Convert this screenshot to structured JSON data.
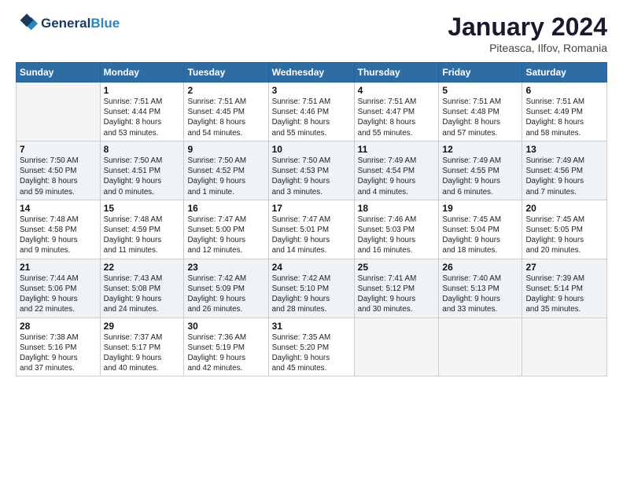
{
  "header": {
    "logo_line1": "General",
    "logo_line2": "Blue",
    "month_title": "January 2024",
    "location": "Piteasca, Ilfov, Romania"
  },
  "days_of_week": [
    "Sunday",
    "Monday",
    "Tuesday",
    "Wednesday",
    "Thursday",
    "Friday",
    "Saturday"
  ],
  "weeks": [
    [
      {
        "num": "",
        "text": ""
      },
      {
        "num": "1",
        "text": "Sunrise: 7:51 AM\nSunset: 4:44 PM\nDaylight: 8 hours\nand 53 minutes."
      },
      {
        "num": "2",
        "text": "Sunrise: 7:51 AM\nSunset: 4:45 PM\nDaylight: 8 hours\nand 54 minutes."
      },
      {
        "num": "3",
        "text": "Sunrise: 7:51 AM\nSunset: 4:46 PM\nDaylight: 8 hours\nand 55 minutes."
      },
      {
        "num": "4",
        "text": "Sunrise: 7:51 AM\nSunset: 4:47 PM\nDaylight: 8 hours\nand 55 minutes."
      },
      {
        "num": "5",
        "text": "Sunrise: 7:51 AM\nSunset: 4:48 PM\nDaylight: 8 hours\nand 57 minutes."
      },
      {
        "num": "6",
        "text": "Sunrise: 7:51 AM\nSunset: 4:49 PM\nDaylight: 8 hours\nand 58 minutes."
      }
    ],
    [
      {
        "num": "7",
        "text": "Sunrise: 7:50 AM\nSunset: 4:50 PM\nDaylight: 8 hours\nand 59 minutes."
      },
      {
        "num": "8",
        "text": "Sunrise: 7:50 AM\nSunset: 4:51 PM\nDaylight: 9 hours\nand 0 minutes."
      },
      {
        "num": "9",
        "text": "Sunrise: 7:50 AM\nSunset: 4:52 PM\nDaylight: 9 hours\nand 1 minute."
      },
      {
        "num": "10",
        "text": "Sunrise: 7:50 AM\nSunset: 4:53 PM\nDaylight: 9 hours\nand 3 minutes."
      },
      {
        "num": "11",
        "text": "Sunrise: 7:49 AM\nSunset: 4:54 PM\nDaylight: 9 hours\nand 4 minutes."
      },
      {
        "num": "12",
        "text": "Sunrise: 7:49 AM\nSunset: 4:55 PM\nDaylight: 9 hours\nand 6 minutes."
      },
      {
        "num": "13",
        "text": "Sunrise: 7:49 AM\nSunset: 4:56 PM\nDaylight: 9 hours\nand 7 minutes."
      }
    ],
    [
      {
        "num": "14",
        "text": "Sunrise: 7:48 AM\nSunset: 4:58 PM\nDaylight: 9 hours\nand 9 minutes."
      },
      {
        "num": "15",
        "text": "Sunrise: 7:48 AM\nSunset: 4:59 PM\nDaylight: 9 hours\nand 11 minutes."
      },
      {
        "num": "16",
        "text": "Sunrise: 7:47 AM\nSunset: 5:00 PM\nDaylight: 9 hours\nand 12 minutes."
      },
      {
        "num": "17",
        "text": "Sunrise: 7:47 AM\nSunset: 5:01 PM\nDaylight: 9 hours\nand 14 minutes."
      },
      {
        "num": "18",
        "text": "Sunrise: 7:46 AM\nSunset: 5:03 PM\nDaylight: 9 hours\nand 16 minutes."
      },
      {
        "num": "19",
        "text": "Sunrise: 7:45 AM\nSunset: 5:04 PM\nDaylight: 9 hours\nand 18 minutes."
      },
      {
        "num": "20",
        "text": "Sunrise: 7:45 AM\nSunset: 5:05 PM\nDaylight: 9 hours\nand 20 minutes."
      }
    ],
    [
      {
        "num": "21",
        "text": "Sunrise: 7:44 AM\nSunset: 5:06 PM\nDaylight: 9 hours\nand 22 minutes."
      },
      {
        "num": "22",
        "text": "Sunrise: 7:43 AM\nSunset: 5:08 PM\nDaylight: 9 hours\nand 24 minutes."
      },
      {
        "num": "23",
        "text": "Sunrise: 7:42 AM\nSunset: 5:09 PM\nDaylight: 9 hours\nand 26 minutes."
      },
      {
        "num": "24",
        "text": "Sunrise: 7:42 AM\nSunset: 5:10 PM\nDaylight: 9 hours\nand 28 minutes."
      },
      {
        "num": "25",
        "text": "Sunrise: 7:41 AM\nSunset: 5:12 PM\nDaylight: 9 hours\nand 30 minutes."
      },
      {
        "num": "26",
        "text": "Sunrise: 7:40 AM\nSunset: 5:13 PM\nDaylight: 9 hours\nand 33 minutes."
      },
      {
        "num": "27",
        "text": "Sunrise: 7:39 AM\nSunset: 5:14 PM\nDaylight: 9 hours\nand 35 minutes."
      }
    ],
    [
      {
        "num": "28",
        "text": "Sunrise: 7:38 AM\nSunset: 5:16 PM\nDaylight: 9 hours\nand 37 minutes."
      },
      {
        "num": "29",
        "text": "Sunrise: 7:37 AM\nSunset: 5:17 PM\nDaylight: 9 hours\nand 40 minutes."
      },
      {
        "num": "30",
        "text": "Sunrise: 7:36 AM\nSunset: 5:19 PM\nDaylight: 9 hours\nand 42 minutes."
      },
      {
        "num": "31",
        "text": "Sunrise: 7:35 AM\nSunset: 5:20 PM\nDaylight: 9 hours\nand 45 minutes."
      },
      {
        "num": "",
        "text": ""
      },
      {
        "num": "",
        "text": ""
      },
      {
        "num": "",
        "text": ""
      }
    ]
  ]
}
